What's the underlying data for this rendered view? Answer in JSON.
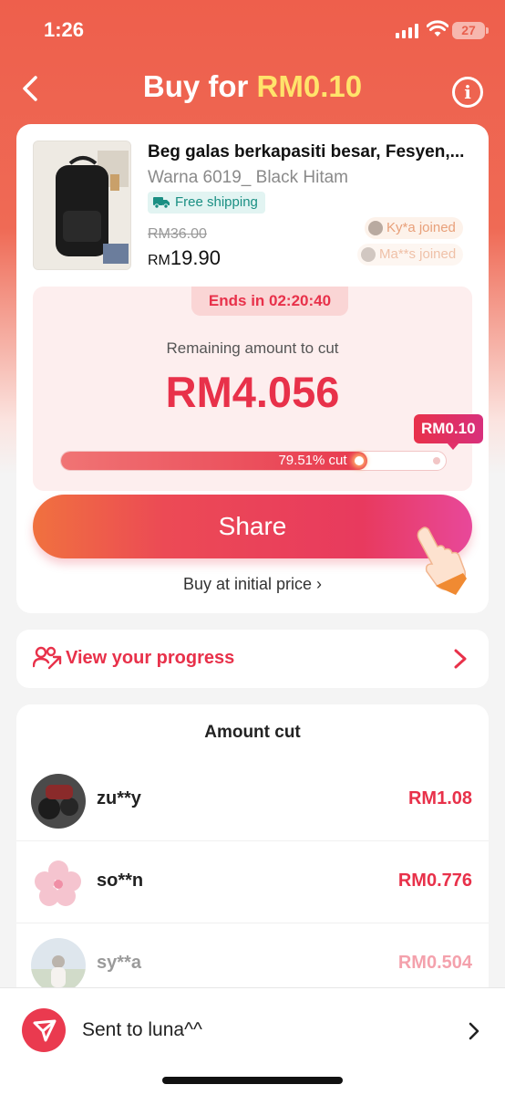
{
  "status_bar": {
    "time": "1:26",
    "battery": "27"
  },
  "header": {
    "title_prefix": "Buy for ",
    "title_price": "RM0.10",
    "info_glyph": "i"
  },
  "product": {
    "name": "Beg galas berkapasiti besar, Fesyen,...",
    "variant": "Warna 6019_ Black Hitam",
    "shipping": "Free shipping",
    "original_price": "RM36.00",
    "currency": "RM",
    "price": "19.90",
    "joined": [
      "Ky*a joined",
      "Ma**s joined"
    ]
  },
  "cut": {
    "ends_in": "Ends in 02:20:40",
    "remaining_label": "Remaining amount to cut",
    "remaining_amount": "RM4.056",
    "target_tag": "RM0.10",
    "progress_label": "79.51% cut",
    "progress_fraction": 0.7951
  },
  "actions": {
    "share": "Share",
    "buy_initial": "Buy at initial price ›"
  },
  "progress_link": {
    "label": "View your progress"
  },
  "amount_cut": {
    "title": "Amount cut",
    "rows": [
      {
        "name": "zu**y",
        "amount": "RM1.08"
      },
      {
        "name": "so**n",
        "amount": "RM0.776"
      },
      {
        "name": "sy**a",
        "amount": "RM0.504"
      }
    ]
  },
  "bottom": {
    "label": "Sent to luna^^"
  },
  "colors": {
    "accent": "#e8314a",
    "header_bg": "#ee5f4c",
    "price_highlight": "#ffe36b"
  }
}
